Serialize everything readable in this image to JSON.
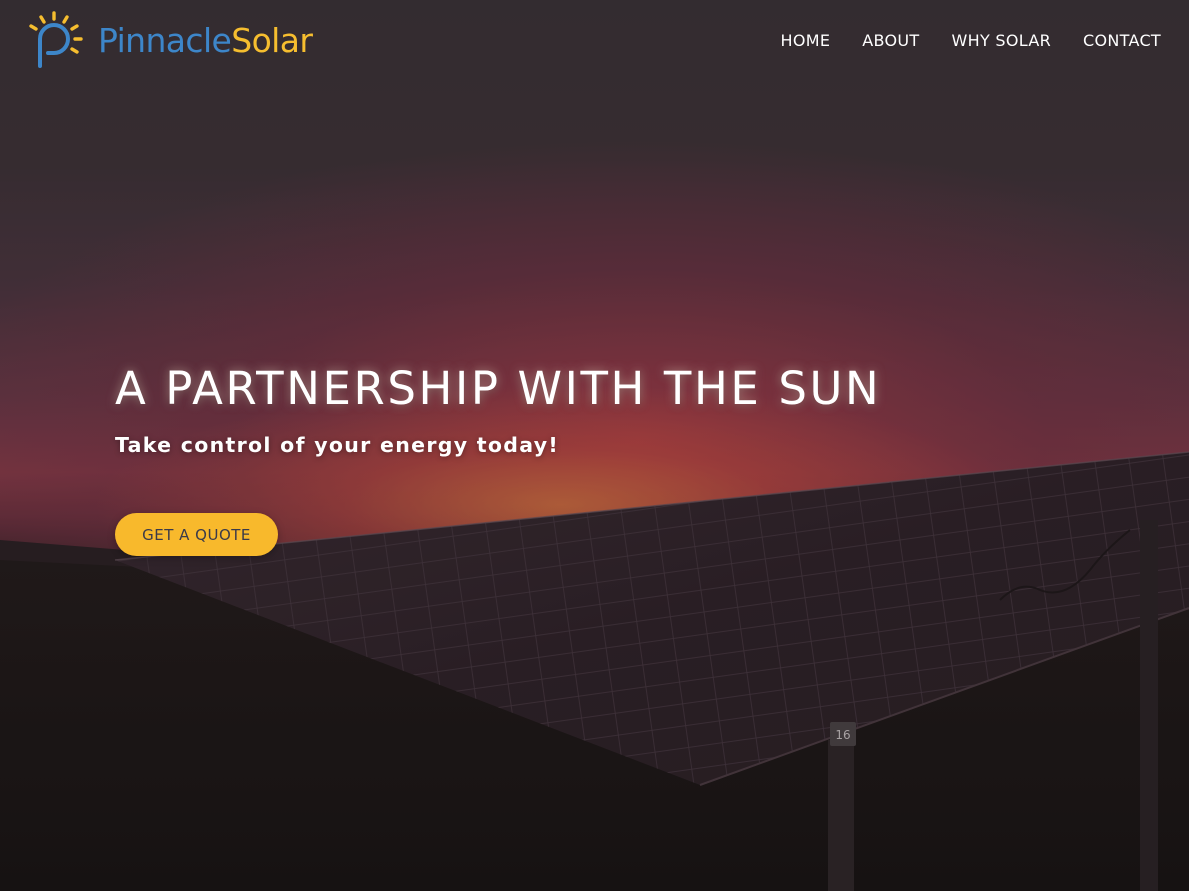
{
  "brand": {
    "name_part1": "Pinnacle",
    "name_part2": "Solar",
    "logo_icon": "sun-pin-icon",
    "colors": {
      "blue": "#3d86c9",
      "yellow": "#f6be2f"
    }
  },
  "nav": {
    "items": [
      {
        "label": "HOME"
      },
      {
        "label": "ABOUT"
      },
      {
        "label": "WHY SOLAR"
      },
      {
        "label": "CONTACT"
      }
    ]
  },
  "hero": {
    "headline": "A PARTNERSHIP WITH THE SUN",
    "subheadline": "Take control of your energy today!",
    "cta_label": "GET A QUOTE",
    "cta_color": "#f8b92c",
    "panel_marker": "16"
  }
}
